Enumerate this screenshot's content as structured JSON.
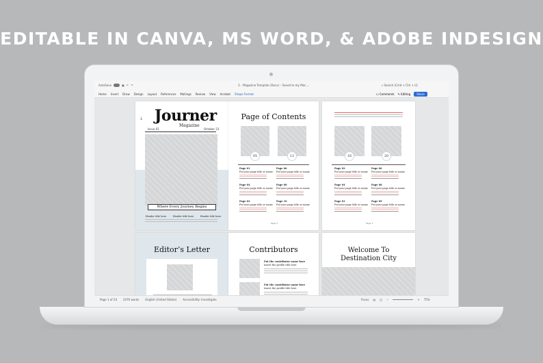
{
  "headline": "EDITABLE IN CANVA, MS WORD, & ADOBE INDESIGN",
  "word": {
    "titlebar": {
      "autosave": "AutoSave",
      "doc_title": "3 – Magazine Template (Docx) – Saved to my Mac ⌄",
      "search": "Search (Cmd + Ctrl + U)"
    },
    "tabs": [
      "Home",
      "Insert",
      "Draw",
      "Design",
      "Layout",
      "References",
      "Mailings",
      "Review",
      "View",
      "Acrobat",
      "Shape Format"
    ],
    "active_tab": "Shape Format",
    "comments": "Comments",
    "editing": "Editing",
    "share": "Share",
    "status": {
      "page": "Page 1 of 24",
      "words": "2470 words",
      "language": "English (United States)",
      "accessibility": "Accessibility: Investigate",
      "focus": "Focus",
      "zoom": "75%"
    }
  },
  "pages": {
    "cover": {
      "masthead": "Journer",
      "subtitle": "Magazine",
      "issue": "Issue 01",
      "date": "October 23",
      "tagline": "Where Every Journey Begins",
      "headers": [
        "Header title here",
        "Header title here",
        "Header title here"
      ]
    },
    "contents": {
      "title": "Page of Contents",
      "nums": [
        "05",
        "12"
      ],
      "entries": [
        {
          "page": "Page 01",
          "title": "Put your page title or name"
        },
        {
          "page": "Page 06",
          "title": "Put your page title or name"
        },
        {
          "page": "Page 04",
          "title": "Put your page title or name"
        },
        {
          "page": "Page 08",
          "title": "Put your page title or name"
        },
        {
          "page": "Page 02",
          "title": "Put your page title or name"
        },
        {
          "page": "Page 10",
          "title": "Put your page title or name"
        }
      ],
      "footer": "Page 2"
    },
    "contents2": {
      "nums": [
        "16",
        "20"
      ],
      "entries": [
        {
          "page": "Page 02",
          "title": "Put your page title or name"
        },
        {
          "page": "Page 06",
          "title": "Put your page title or name"
        },
        {
          "page": "Page 04",
          "title": "Put your page title or name"
        },
        {
          "page": "Page 08",
          "title": "Put your page title or name"
        },
        {
          "page": "Page 03",
          "title": "Put your page title or name"
        },
        {
          "page": "Page 09",
          "title": "Put your page title or name"
        }
      ],
      "footer": "Page 3"
    },
    "editor": {
      "title": "Editor’s Letter"
    },
    "contributors": {
      "title": "Contributors",
      "items": [
        {
          "name": "Put the contributor name here",
          "sub": "Insert the profile title here"
        },
        {
          "name": "Put the contributor name here",
          "sub": "Insert the profile title here"
        }
      ]
    },
    "welcome": {
      "title_line1": "Welcome To",
      "title_line2": "Destination City"
    }
  },
  "colors": {
    "share": "#2b6bd6",
    "accent_tab": "#2b5fb8",
    "cover_band": "#dfe7ec",
    "background": "#b7b8ba"
  }
}
